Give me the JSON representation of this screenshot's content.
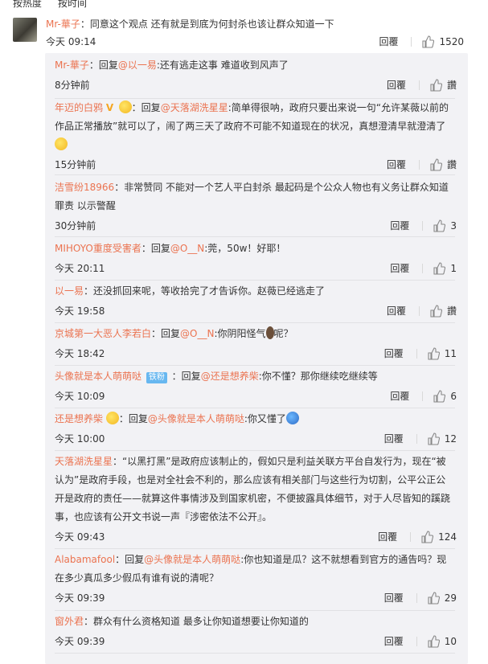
{
  "sort": {
    "hot": "按热度",
    "time": "按时间"
  },
  "main": {
    "author": "Mr-華子",
    "text": "：同意这个观点 还有就是到底为何封杀也该让群众知道一下",
    "time": "今天 09:14",
    "reply_label": "回覆",
    "likes": "1520"
  },
  "replies": [
    {
      "author": "Mr-華子",
      "parts": [
        "：回复",
        "@以一易",
        ":还有逃走这事 难道收到风声了"
      ],
      "time": "8分钟前",
      "reply_label": "回覆",
      "likes": "讚"
    },
    {
      "author": "年迈的白鸦",
      "parts": [
        "：回复",
        "@天落湖洗星星",
        ":简单得很呐，政府只要出来说一句“允许某薇以前的作品正常播放”就可以了，闹了两三天了政府不可能不知道现在的状况，真想澄清早就澄清了"
      ],
      "time": "15分钟前",
      "reply_label": "回覆",
      "likes": "讚"
    },
    {
      "author": "洁雪纷18966",
      "parts": [
        "：非常赞同  不能对一个艺人平白封杀  最起码是个公众人物也有义务让群众知道  罪责  以示警醒"
      ],
      "time": "30分钟前",
      "reply_label": "回覆",
      "likes": "3"
    },
    {
      "author": "MIHOYO重度受害者",
      "parts": [
        "：回复",
        "@O__N",
        ":莞，50w！好耶！"
      ],
      "time": "今天 20:11",
      "reply_label": "回覆",
      "likes": "1"
    },
    {
      "author": "以一易",
      "parts": [
        "：还没抓回来呢，等收拾完了才告诉你。赵薇已经逃走了"
      ],
      "time": "今天 19:58",
      "reply_label": "回覆",
      "likes": "讚"
    },
    {
      "author": "京城第一大恶人李若白",
      "parts": [
        "：回复",
        "@O__N",
        ":你阴阳怪气",
        "呢？"
      ],
      "time": "今天 18:42",
      "reply_label": "回覆",
      "likes": "11"
    },
    {
      "author": "头像就是本人萌萌哒",
      "badge": "铁粉",
      "parts": [
        "：回复",
        "@还是想养柴",
        ":你不懂？那你继续吃继续等"
      ],
      "time": "今天 10:09",
      "reply_label": "回覆",
      "likes": "6"
    },
    {
      "author": "还是想养柴",
      "parts": [
        "：回复",
        "@头像就是本人萌萌哒",
        ":你又懂了"
      ],
      "time": "今天 10:00",
      "reply_label": "回覆",
      "likes": "12"
    },
    {
      "author": "天落湖洗星星",
      "parts": [
        "：“以黑打黑”是政府应该制止的，假如只是利益关联方平台自发行为，现在“被认为”是政府手段，也是对全社会不利的，那么应该有相关部门与这些行为切割，公平公正公开是政府的责任——就算这件事情涉及到国家机密，不便披露具体细节，对于人尽皆知的蹊跷事，也应该有公开文书说一声『涉密依法不公开』。"
      ],
      "time": "今天 09:43",
      "reply_label": "回覆",
      "likes": "124"
    },
    {
      "author": "Alabamafool",
      "parts": [
        "：回复",
        "@头像就是本人萌萌哒",
        ":你也知道是瓜？这不就想看到官方的通告吗？现在多少真瓜多少假瓜有谁有说的清呢？"
      ],
      "time": "今天 09:39",
      "reply_label": "回覆",
      "likes": "29"
    },
    {
      "author": "窗外君",
      "parts": [
        "：群众有什么资格知道 最多让你知道想要让你知道的"
      ],
      "time": "今天 09:39",
      "reply_label": "回覆",
      "likes": "10"
    }
  ],
  "colors": {
    "link": "#eb7350",
    "text": "#333333",
    "sub_bg": "#f2f2f5"
  }
}
